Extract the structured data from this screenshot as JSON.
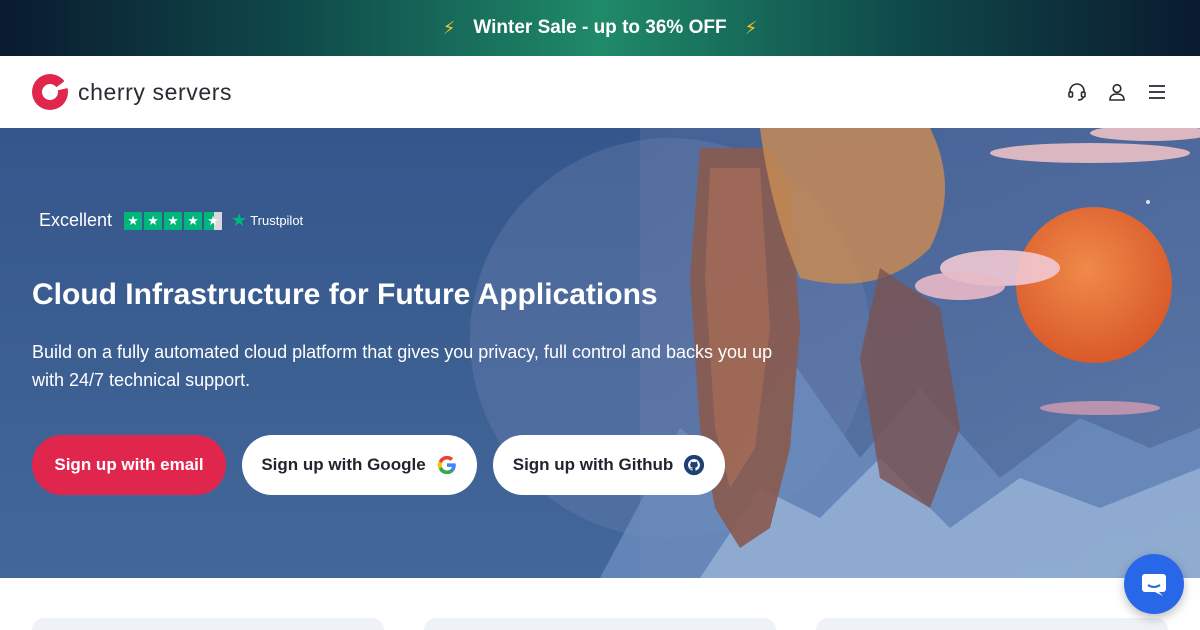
{
  "promo": {
    "text": "Winter Sale - up to 36% OFF",
    "bolt_left": "⚡",
    "bolt_right": "⚡"
  },
  "header": {
    "logo_text": "cherry servers",
    "icons": [
      "headset-icon",
      "user-icon",
      "menu-icon"
    ]
  },
  "hero": {
    "rating_label": "Excellent",
    "rating_stars": 4.5,
    "rating_max": 5,
    "trustpilot_label": "Trustpilot",
    "headline": "Cloud Infrastructure for Future Applications",
    "subtext": "Build on a fully automated cloud platform that gives you privacy, full control and backs you up with 24/7 technical support.",
    "buttons": {
      "email": "Sign up with email",
      "google": "Sign up with Google",
      "github": "Sign up with Github"
    }
  },
  "colors": {
    "brand": "#e0264d",
    "hero_bg": "#3b5e91",
    "trustpilot_green": "#00b67a",
    "chat_blue": "#2767e8"
  }
}
